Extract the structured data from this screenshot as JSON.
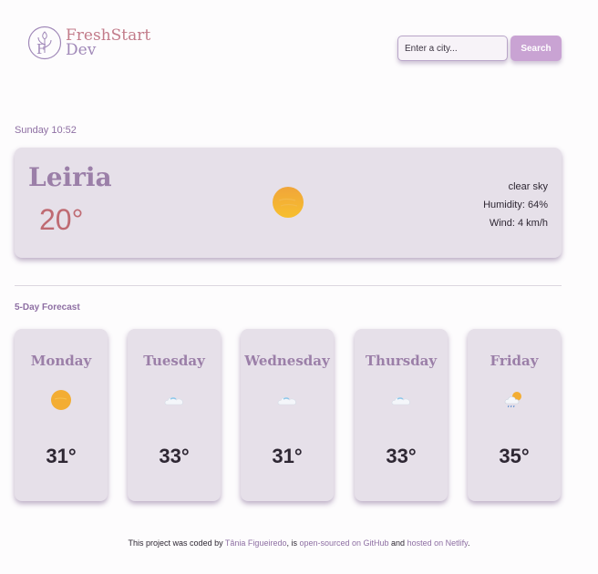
{
  "logo": {
    "line1": "FreshStart",
    "line2": "Dev",
    "mark_letter": "F"
  },
  "search": {
    "placeholder": "Enter a city...",
    "button_label": "Search"
  },
  "current": {
    "datetime": "Sunday 10:52",
    "city": "Leiria",
    "temperature": "20°",
    "icon": "sun-icon",
    "description": "clear sky",
    "humidity": "Humidity: 64%",
    "wind": "Wind: 4 km/h"
  },
  "forecast": {
    "title": "5-Day Forecast",
    "days": [
      {
        "name": "Monday",
        "temp": "31°",
        "icon": "sun-icon"
      },
      {
        "name": "Tuesday",
        "temp": "33°",
        "icon": "cloud-icon"
      },
      {
        "name": "Wednesday",
        "temp": "31°",
        "icon": "cloud-icon"
      },
      {
        "name": "Thursday",
        "temp": "33°",
        "icon": "cloud-icon"
      },
      {
        "name": "Friday",
        "temp": "35°",
        "icon": "sun-cloud-rain-icon"
      }
    ]
  },
  "footer": {
    "prefix": "This project was coded by ",
    "author": "Tânia Figueiredo",
    "mid1": ", is ",
    "github": "open-sourced on GitHub",
    "mid2": " and ",
    "netlify": "hosted on Netlify",
    "suffix": "."
  },
  "colors": {
    "accent": "#9b7fa8",
    "temperature": "#bf6a72",
    "card_bg": "#e6e0e9",
    "button_bg": "#c9a3d3"
  }
}
